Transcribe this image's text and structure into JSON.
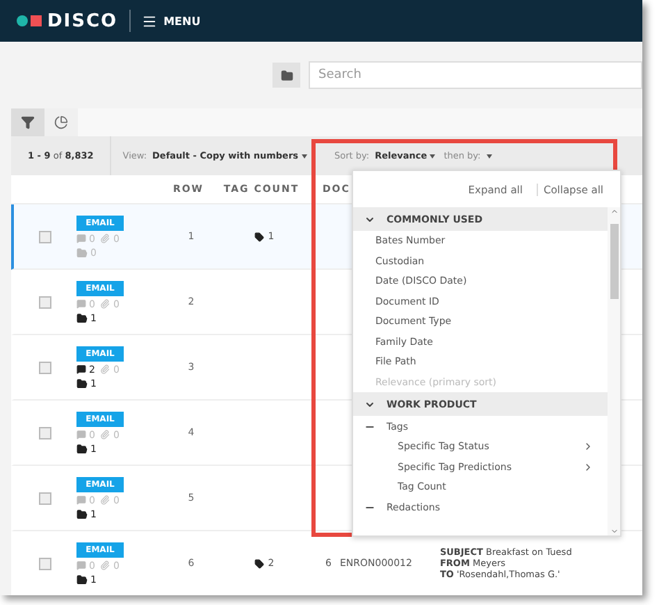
{
  "header": {
    "brand": "DISCO",
    "menu": "MENU"
  },
  "search": {
    "placeholder": "Search"
  },
  "tabs": [
    {
      "selected": true
    },
    {
      "selected": false
    }
  ],
  "toolbar": {
    "count_range": "1 - 9",
    "count_of": "of",
    "count_total": "8,832",
    "view_label": "View:",
    "view_value": "Default - Copy with numbers",
    "sort_label": "Sort by:",
    "sort_value": "Relevance",
    "then_label": "then by:"
  },
  "table": {
    "columns": [
      "ROW",
      "TAG COUNT",
      "DOC"
    ],
    "rows": [
      {
        "selected": true,
        "checked": false,
        "badge": "EMAIL",
        "comments": "0",
        "attachments": "0",
        "folders": "0",
        "row": "1",
        "tag_count": "1"
      },
      {
        "selected": false,
        "checked": false,
        "badge": "EMAIL",
        "comments": "0",
        "attachments": "0",
        "folders": "1",
        "row": "2"
      },
      {
        "selected": false,
        "checked": false,
        "badge": "EMAIL",
        "comments": "2",
        "attachments": "0",
        "folders": "1",
        "row": "3"
      },
      {
        "selected": false,
        "checked": false,
        "badge": "EMAIL",
        "comments": "0",
        "attachments": "0",
        "folders": "1",
        "row": "4"
      },
      {
        "selected": false,
        "checked": false,
        "badge": "EMAIL",
        "comments": "0",
        "attachments": "0",
        "folders": "1",
        "row": "5"
      },
      {
        "selected": false,
        "checked": false,
        "badge": "EMAIL",
        "comments": "0",
        "attachments": "0",
        "folders": "1",
        "row": "6",
        "tag_count": "2",
        "doc_number": "6",
        "doc_id": "ENRON000012",
        "preview": [
          {
            "field": "SUBJECT",
            "value": "Breakfast on Tuesd"
          },
          {
            "field": "FROM",
            "value": "Meyers"
          },
          {
            "field": "TO",
            "value": "'Rosendahl,Thomas G.'"
          }
        ]
      }
    ]
  },
  "sort_menu": {
    "expand_all": "Expand all",
    "collapse_all": "Collapse all",
    "sections": [
      {
        "title": "COMMONLY USED",
        "expanded": true,
        "items": [
          {
            "label": "Bates Number",
            "disabled": false
          },
          {
            "label": "Custodian",
            "disabled": false
          },
          {
            "label": "Date (DISCO Date)",
            "disabled": false
          },
          {
            "label": "Document ID",
            "disabled": false
          },
          {
            "label": "Document Type",
            "disabled": false
          },
          {
            "label": "Family Date",
            "disabled": false
          },
          {
            "label": "File Path",
            "disabled": false
          },
          {
            "label": "Relevance (primary sort)",
            "disabled": true
          }
        ]
      },
      {
        "title": "WORK PRODUCT",
        "expanded": true,
        "groups": [
          {
            "label": "Tags",
            "expanded": true,
            "children": [
              {
                "label": "Specific Tag Status",
                "submenu": true
              },
              {
                "label": "Specific Tag Predictions",
                "submenu": true
              },
              {
                "label": "Tag Count",
                "submenu": false
              }
            ]
          },
          {
            "label": "Redactions",
            "expanded": true
          }
        ]
      }
    ]
  }
}
